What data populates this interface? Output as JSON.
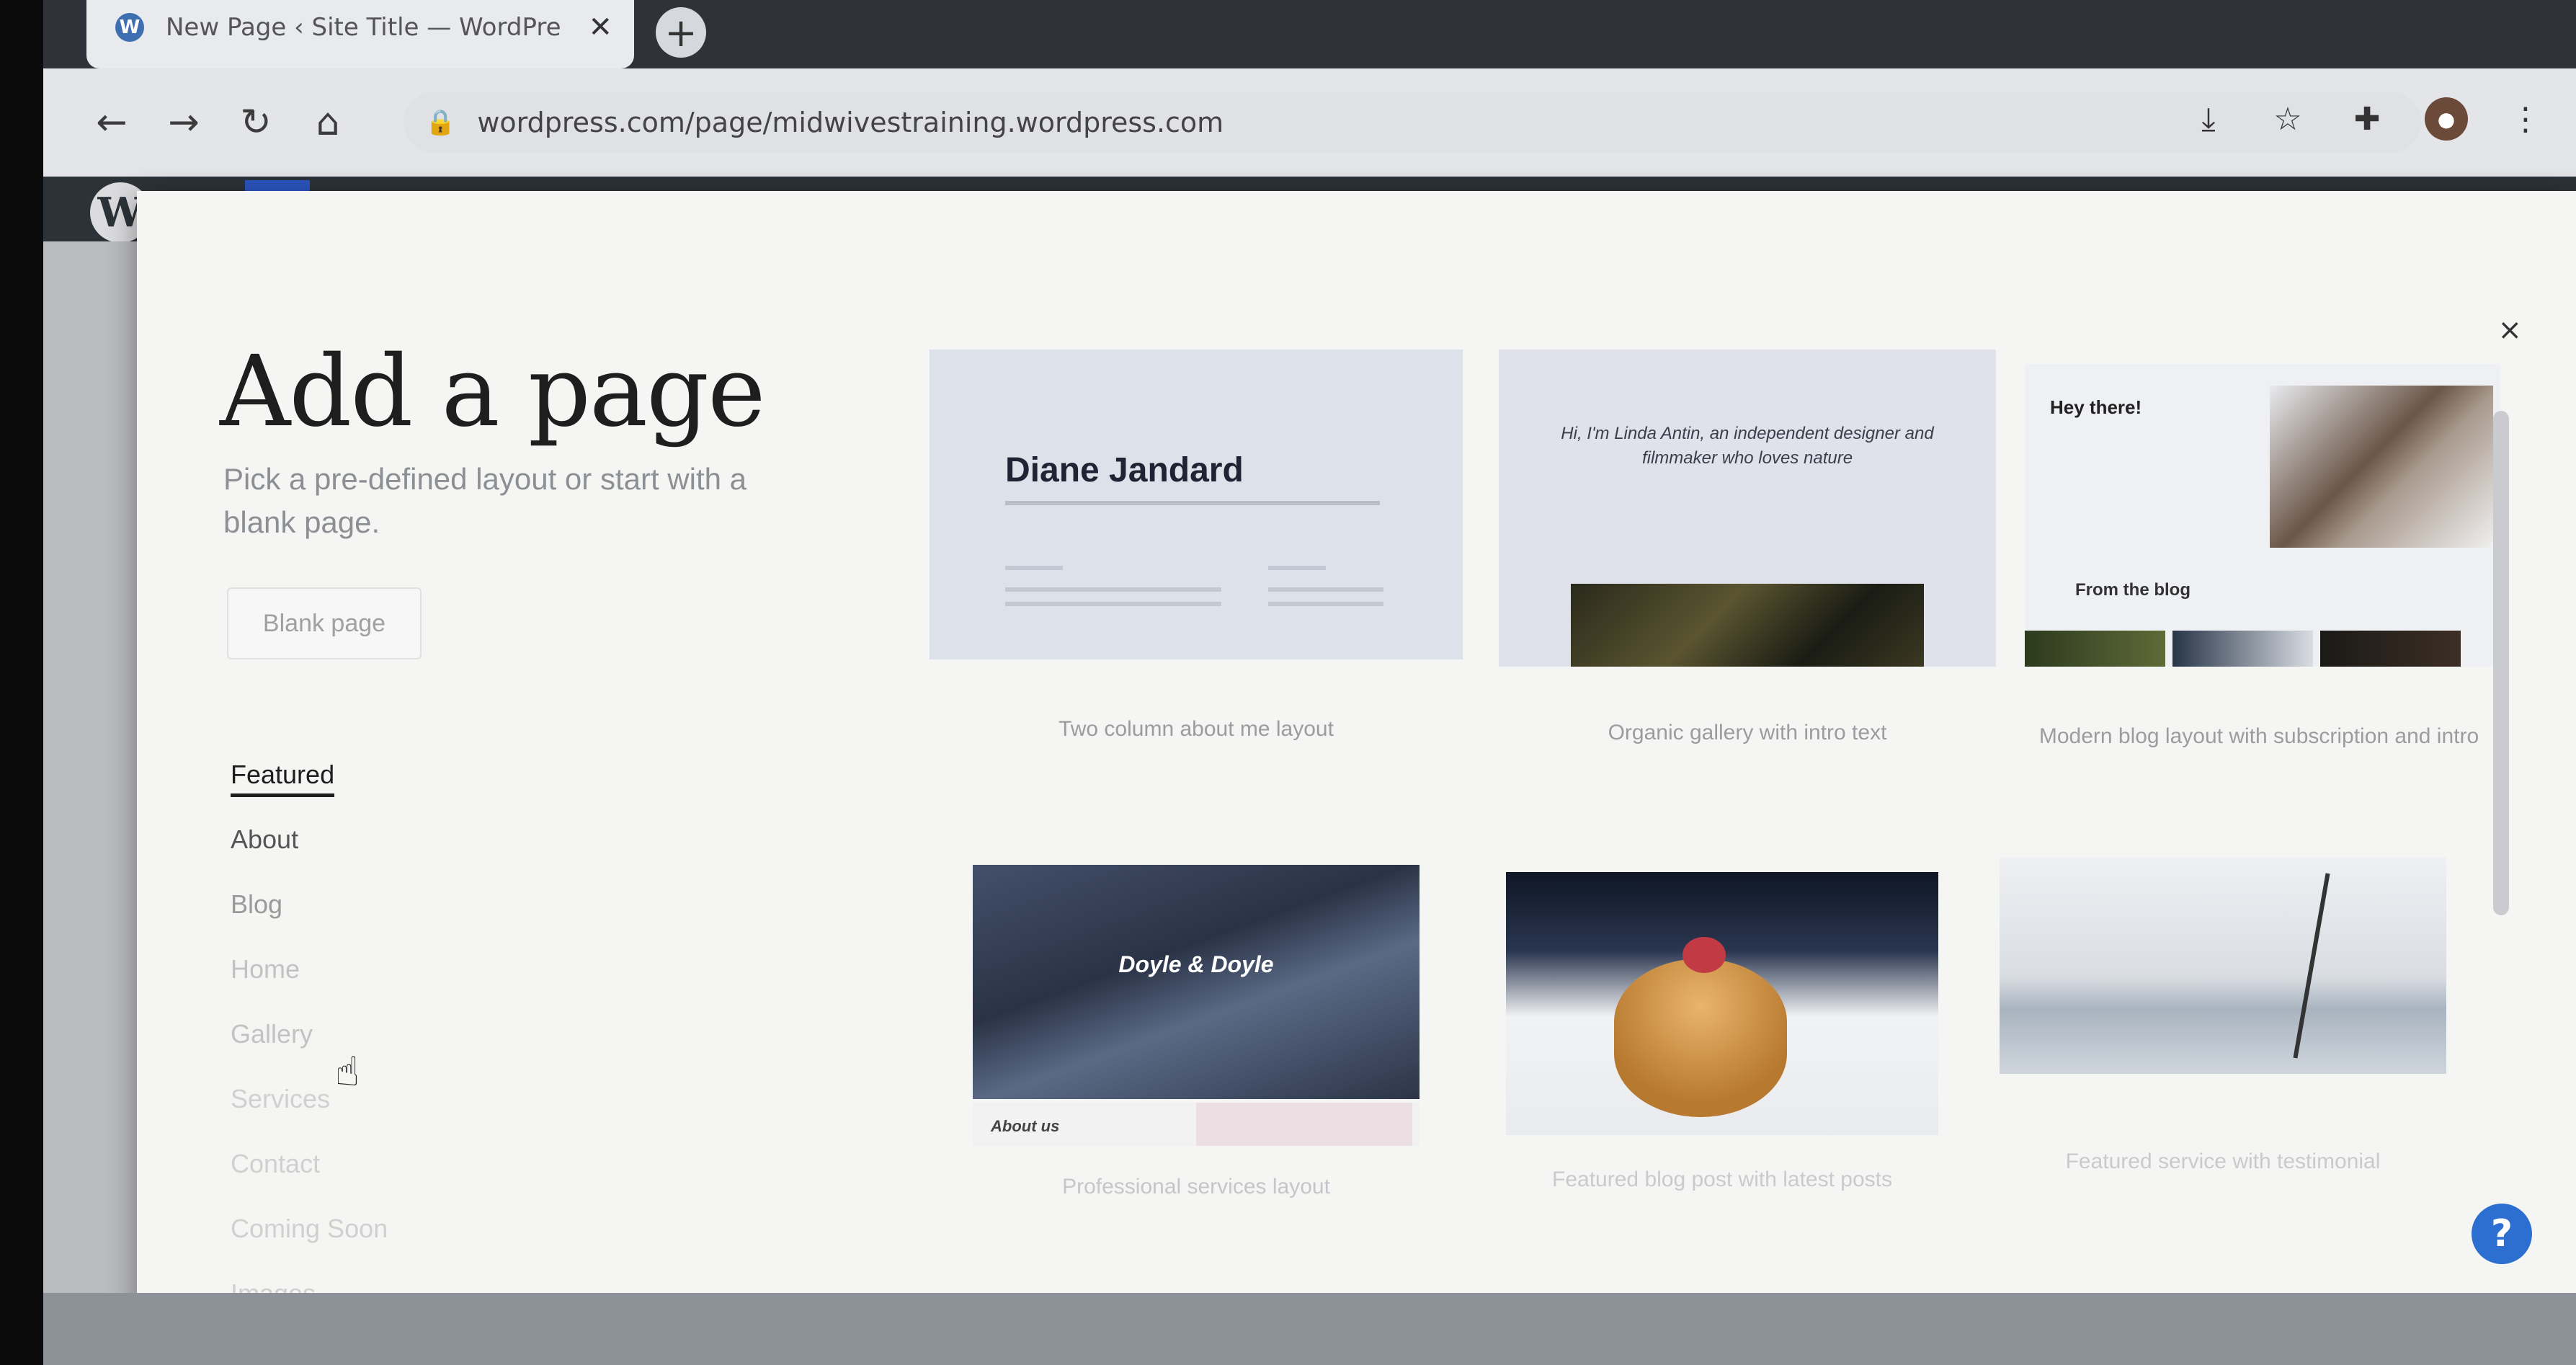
{
  "browser": {
    "tab_title": "New Page ‹ Site Title — WordPre",
    "tab_close": "✕",
    "new_tab": "+",
    "url": "wordpress.com/page/midwivestraining.wordpress.com",
    "nav": {
      "back": "←",
      "forward": "→",
      "reload": "↻",
      "home": "⌂"
    }
  },
  "modal": {
    "title": "Add a page",
    "subtitle": "Pick a pre-defined layout or start with a blank page.",
    "blank_page": "Blank page",
    "close": "×",
    "categories": [
      "Featured",
      "About",
      "Blog",
      "Home",
      "Gallery",
      "Services",
      "Contact",
      "Coming Soon",
      "Images"
    ],
    "layouts": [
      {
        "label": "Two column about me layout",
        "preview_name": "Diane Jandard"
      },
      {
        "label": "Organic gallery with intro text",
        "preview_text": "Hi, I'm Linda Antin, an independent designer and filmmaker who loves nature"
      },
      {
        "label": "Modern blog layout with subscription and intro",
        "preview_heading": "Hey there!",
        "preview_sub": "From the blog"
      },
      {
        "label": "Professional services layout",
        "preview_name": "Doyle & Doyle",
        "preview_sub": "About us"
      },
      {
        "label": "Featured blog post with latest posts"
      },
      {
        "label": "Featured service with testimonial"
      }
    ],
    "help": "?"
  }
}
